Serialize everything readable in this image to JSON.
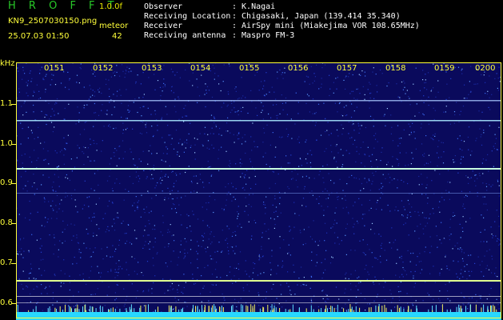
{
  "header": {
    "app_title": "H R O F F T",
    "version": "1.0.0f",
    "filename": "KN9_2507030150.png",
    "mode": "meteor",
    "timestamp": "25.07.03 01:50",
    "count": "42",
    "meta": [
      {
        "label": "Observer",
        "value": ": K.Nagai"
      },
      {
        "label": "Receiving Location",
        "value": ": Chigasaki, Japan (139.414 35.340)"
      },
      {
        "label": "Receiver",
        "value": ": AirSpy mini (Miakejima VOR 108.65MHz)"
      },
      {
        "label": "Receiving antenna",
        "value": ": Maspro FM-3"
      }
    ]
  },
  "axes": {
    "y_unit": "kHz",
    "y_ticks": [
      "1.1",
      "1.0",
      "0.9",
      "0.8",
      "0.7",
      "0.6"
    ],
    "x_ticks": [
      "0151",
      "0152",
      "0153",
      "0154",
      "0155",
      "0156",
      "0157",
      "0158",
      "0159",
      "0200"
    ]
  },
  "colors": {
    "background": "#0a0a5c",
    "axis": "#ffff3a",
    "beacon": "#d0e8ff",
    "noise_floor": "#28d8ff"
  }
}
